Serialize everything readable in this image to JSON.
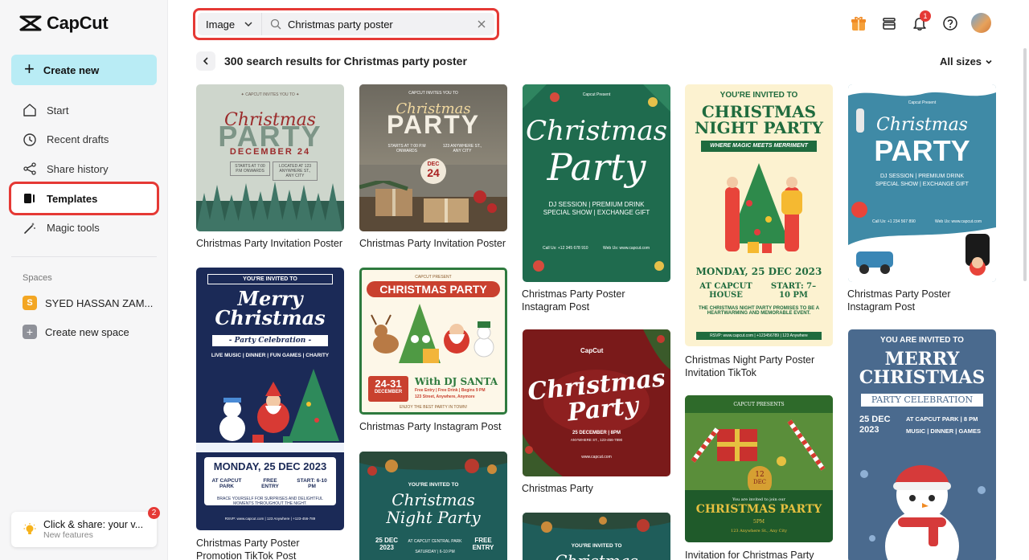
{
  "brand": {
    "name": "CapCut"
  },
  "sidebar": {
    "create_label": "Create new",
    "items": [
      {
        "label": "Start",
        "icon": "home-icon"
      },
      {
        "label": "Recent drafts",
        "icon": "clock-icon"
      },
      {
        "label": "Share history",
        "icon": "share-icon"
      },
      {
        "label": "Templates",
        "icon": "templates-icon",
        "active": true
      },
      {
        "label": "Magic tools",
        "icon": "magic-wand-icon"
      }
    ],
    "spaces_label": "Spaces",
    "space_name": "SYED HASSAN ZAM...",
    "space_initial": "S",
    "create_space_label": "Create new space",
    "promo": {
      "title": "Click & share: your v...",
      "subtitle": "New features",
      "badge": "2"
    }
  },
  "search": {
    "type_label": "Image",
    "query": "Christmas party poster"
  },
  "topbar": {
    "notification_count": "1"
  },
  "results": {
    "title": "300 search results for Christmas party poster",
    "sizes_label": "All sizes"
  },
  "cards": [
    {
      "caption1": "Christmas Party Invitation Poster",
      "caption2": "",
      "texts": [
        "✦ CAPCUT INVITES YOU TO ✦",
        "Christmas",
        "PARTY",
        "DECEMBER 24",
        "STARTS AT 7:00 P.M ONWARDS",
        "LOCATED AT 123 ANYWHERE ST., ANY CITY"
      ]
    },
    {
      "caption1": "Christmas Party Invitation Poster",
      "caption2": "",
      "texts": [
        "CAPCUT INVITES YOU TO",
        "Christmas",
        "PARTY",
        "STARTS AT 7:00 P.M ONWARDS",
        "123 ANYWHERE ST., ANY CITY",
        "DEC",
        "24"
      ]
    },
    {
      "caption1": "Christmas Party Poster",
      "caption2": "Instagram Post",
      "texts": [
        "Capcut Present",
        "Christmas",
        "Party",
        "DJ SESSION | PREMIUM DRINK",
        "SPECIAL SHOW | EXCHANGE GIFT",
        "Call Us: +12 345 678 910",
        "Web Us: www.capcut.com"
      ]
    },
    {
      "caption1": "Christmas Night Party Poster",
      "caption2": "Invitation TikTok",
      "texts": [
        "YOU'RE INVITED TO",
        "CHRISTMAS",
        "NIGHT PARTY",
        "WHERE MAGIC MEETS MERRIMENT",
        "MONDAY, 25 DEC 2023",
        "AT CAPCUT HOUSE",
        "START: 7–10 PM",
        "THE CHRISTMAS NIGHT PARTY PROMISES TO BE A HEARTWARMING AND MEMORABLE EVENT.",
        "RSVP: www.capcut.com | +123456789 | 123 Anywhere"
      ]
    },
    {
      "caption1": "Christmas Party Poster",
      "caption2": "Instagram Post",
      "texts": [
        "Capcut Present",
        "Christmas",
        "PARTY",
        "DJ SESSION | PREMIUM DRINK",
        "SPECIAL SHOW | EXCHANGE GIFT",
        "Call Us: +1 234 567 890",
        "Web Us: www.capcut.com"
      ]
    },
    {
      "caption1": "Christmas Party Poster",
      "caption2": "Promotion TikTok Post",
      "texts": [
        "YOU'RE INVITED TO",
        "Merry",
        "Christmas",
        "- Party Celebration -",
        "LIVE MUSIC | DINNER | FUN GAMES | CHARITY",
        "MONDAY, 25 DEC 2023",
        "AT CAPCUT PARK",
        "FREE ENTRY",
        "START: 6-10 PM",
        "BRACE YOURSELF FOR SURPRISES AND DELIGHTFUL MOMENTS THROUGHOUT THE NIGHT.",
        "RSVP: www.capcut.com | 123 Anywhere | +123-456-789"
      ]
    },
    {
      "caption1": "Christmas Party Instagram Post",
      "caption2": "",
      "texts": [
        "CAPCUT PRESENT",
        "CHRISTMAS PARTY",
        "24-31",
        "DECEMBER",
        "With DJ SANTA",
        "Free Entry | Free Drink | Begins 9 PM",
        "123 Street, Anywhere, Anymore",
        "ENJOY THE BEST PARTY IN TOWN!"
      ]
    },
    {
      "caption1": "",
      "caption2": "",
      "texts": [
        "YOU'RE INVITED TO",
        "Christmas",
        "Night Party",
        "25 DEC 2023",
        "AT CAPCUT CENTRAL PARK",
        "FREE ENTRY",
        "SATURDAY | 6-10 PM"
      ]
    },
    {
      "caption1": "Christmas Party",
      "caption2": "",
      "texts": [
        "CapCut",
        "Christmas",
        "Party",
        "25 DECEMBER | 8PM",
        "ANYWHERE ST., 123-456-7890",
        "www.capcut.com"
      ]
    },
    {
      "caption1": "",
      "caption2": "",
      "texts": [
        "YOU'RE INVITED TO",
        "Christmas"
      ]
    },
    {
      "caption1": "Invitation for Christmas Party",
      "caption2": "",
      "texts": [
        "CAPCUT PRESENTS",
        "12",
        "DEC",
        "You are invited to join our",
        "CHRISTMAS PARTY",
        "5PM",
        "123 Anywhere St., Any City"
      ]
    },
    {
      "caption1": "",
      "caption2": "",
      "texts": [
        "YOU ARE INVITED TO",
        "MERRY",
        "CHRISTMAS",
        "PARTY CELEBRATION",
        "25 DEC",
        "2023",
        "AT CAPCUT PARK | 8 PM",
        "MUSIC | DINNER | GAMES"
      ]
    }
  ]
}
